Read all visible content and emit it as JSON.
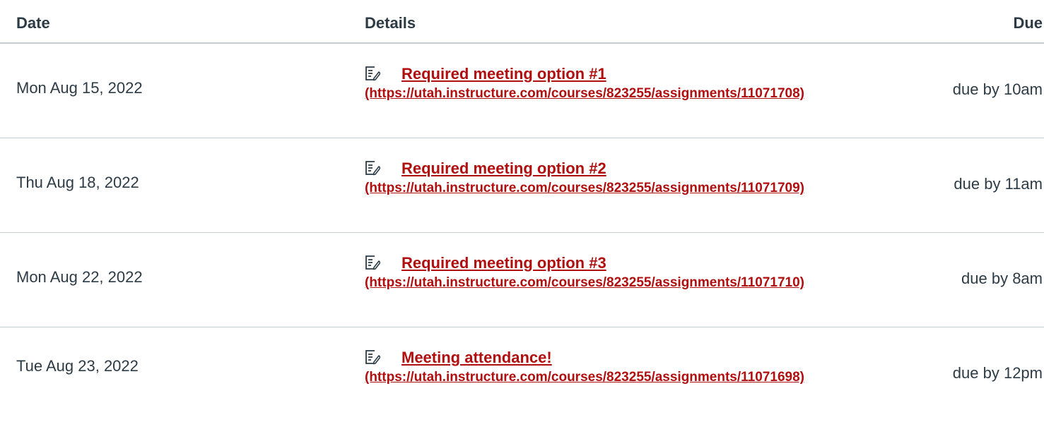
{
  "headers": {
    "date": "Date",
    "details": "Details",
    "due": "Due"
  },
  "colors": {
    "link": "#b00f0f",
    "text": "#2d3b45",
    "divider": "#c7cdd1"
  },
  "rows": [
    {
      "date": "Mon Aug 15, 2022",
      "icon": "assignment-icon",
      "title": "Required meeting option #1",
      "url": "(https://utah.instructure.com/courses/823255/assignments/11071708)",
      "due": "due by 10am"
    },
    {
      "date": "Thu Aug 18, 2022",
      "icon": "assignment-icon",
      "title": "Required meeting option #2",
      "url": "(https://utah.instructure.com/courses/823255/assignments/11071709)",
      "due": "due by 11am"
    },
    {
      "date": "Mon Aug 22, 2022",
      "icon": "assignment-icon",
      "title": "Required meeting option #3",
      "url": "(https://utah.instructure.com/courses/823255/assignments/11071710)",
      "due": "due by 8am"
    },
    {
      "date": "Tue Aug 23, 2022",
      "icon": "assignment-icon",
      "title": "Meeting attendance!",
      "url": "(https://utah.instructure.com/courses/823255/assignments/11071698)",
      "due": "due by 12pm"
    }
  ]
}
